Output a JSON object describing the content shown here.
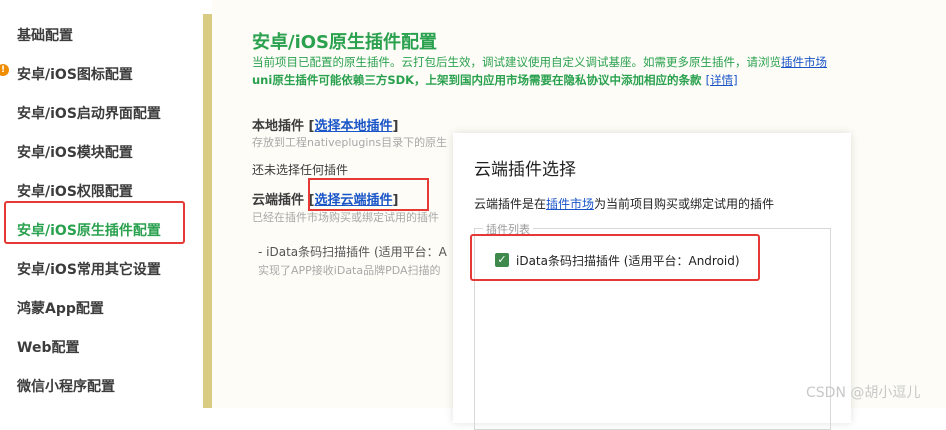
{
  "sidebar": {
    "items": [
      {
        "label": "基础配置"
      },
      {
        "label": "安卓/iOS图标配置",
        "warning": true
      },
      {
        "label": "安卓/iOS启动界面配置"
      },
      {
        "label": "安卓/iOS模块配置"
      },
      {
        "label": "安卓/iOS权限配置"
      },
      {
        "label": "安卓/iOS原生插件配置",
        "active": true
      },
      {
        "label": "安卓/iOS常用其它设置"
      },
      {
        "label": "鸿蒙App配置"
      },
      {
        "label": "Web配置"
      },
      {
        "label": "微信小程序配置"
      }
    ],
    "warning_symbol": "!"
  },
  "main": {
    "title": "安卓/iOS原生插件配置",
    "desc1_text": "当前项目已配置的原生插件。云打包后生效，调试建议使用自定义调试基座。如需更多原生插件，请浏览",
    "desc1_link": "插件市场",
    "desc2_text": "uni原生插件可能依赖三方SDK，上架到国内应用市场需要在隐私协议中添加相应的条款",
    "desc2_link": "[详情]",
    "local": {
      "label": "本地插件",
      "bracket_open": "[",
      "link": "选择本地插件",
      "bracket_close": "]",
      "hint": "存放到工程nativeplugins目录下的原生",
      "none": "还未选择任何插件"
    },
    "cloud": {
      "label": "云端插件",
      "bracket_open": "[",
      "link": "选择云端插件",
      "bracket_close": "]",
      "hint": "已经在插件市场购买或绑定试用的插件",
      "item": "- iData条码扫描插件 (适用平台：A",
      "item_desc": "实现了APP接收iData品牌PDA扫描的"
    }
  },
  "dialog": {
    "title": "云端插件选择",
    "desc_prefix": "云端插件是在",
    "desc_link": "插件市场",
    "desc_suffix": "为当前项目购买或绑定试用的插件",
    "legend": "插件列表",
    "checkbox_mark": "✓",
    "checkbox_checked": true,
    "checkbox_label": "iData条码扫描插件 (适用平台：Android)"
  },
  "watermark": "CSDN @胡小逗儿",
  "colors": {
    "accent_green": "#2aa14f",
    "link_blue": "#1a55c8",
    "highlight_red": "#e53935",
    "divider_gold": "#d9cc82",
    "warning_orange": "#f08c00"
  }
}
